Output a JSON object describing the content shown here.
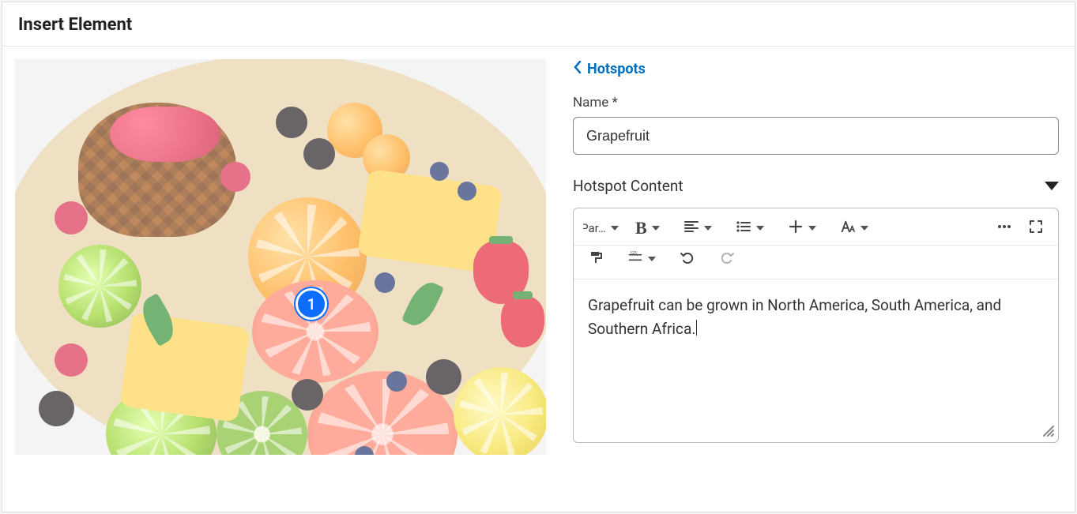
{
  "header": {
    "title": "Insert Element"
  },
  "back": {
    "label": "Hotspots"
  },
  "marker": {
    "number": "1"
  },
  "name": {
    "label": "Name *",
    "value": "Grapefruit"
  },
  "content_section": {
    "title": "Hotspot Content"
  },
  "toolbar": {
    "paragraph_label": "Par…"
  },
  "editor": {
    "text": "Grapefruit can be grown in North America, South America, and Southern Africa."
  }
}
